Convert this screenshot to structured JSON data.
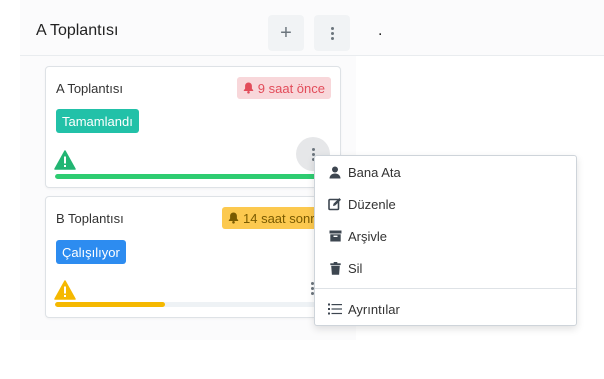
{
  "column": {
    "title": "A Toplantısı",
    "add_label": "+"
  },
  "right_column": {
    "title": "."
  },
  "cards": [
    {
      "title": "A Toplantısı",
      "time": "9 saat önce",
      "status": "Tamamlandı",
      "progress": 1.0,
      "status_color": "#22c1a8",
      "progress_color": "#2ecc71"
    },
    {
      "title": "B Toplantısı",
      "time": "14 saat sonra",
      "status": "Çalışılıyor",
      "progress": 0.4,
      "status_color": "#2d8cf0",
      "progress_color": "#f5b800"
    }
  ],
  "menu": {
    "items": [
      {
        "label": "Bana Ata",
        "icon": "user-icon"
      },
      {
        "label": "Düzenle",
        "icon": "edit-icon"
      },
      {
        "label": "Arşivle",
        "icon": "archive-icon"
      },
      {
        "label": "Sil",
        "icon": "trash-icon"
      },
      {
        "label": "Ayrıntılar",
        "icon": "list-icon"
      }
    ]
  }
}
